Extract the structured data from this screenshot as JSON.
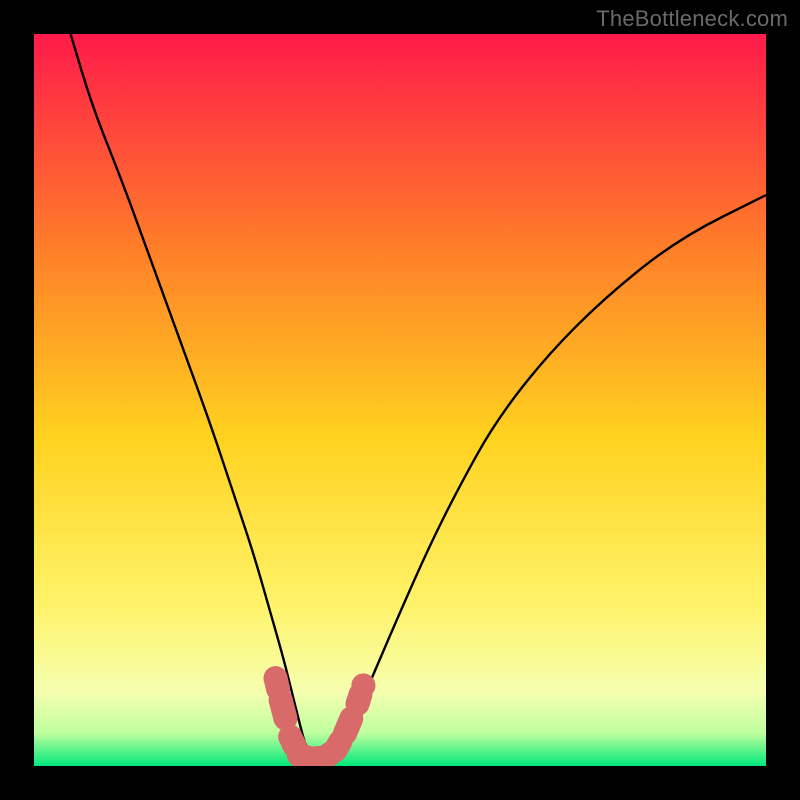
{
  "watermark": "TheBottleneck.com",
  "colors": {
    "frame": "#000000",
    "gradient_top": "#ff1a4a",
    "gradient_mid1": "#ff7a2a",
    "gradient_mid2": "#ffd21f",
    "gradient_mid3": "#fff36a",
    "gradient_mid4": "#f5ffb0",
    "gradient_bottom": "#00e87a",
    "curve": "#000000",
    "marker_fill": "#d86a6a",
    "marker_stroke": "#d86a6a"
  },
  "chart_data": {
    "type": "line",
    "title": "",
    "xlabel": "",
    "ylabel": "",
    "xlim": [
      0,
      100
    ],
    "ylim": [
      0,
      100
    ],
    "grid": false,
    "legend": false,
    "series": [
      {
        "name": "bottleneck-curve",
        "x": [
          5,
          8,
          12,
          16,
          20,
          24,
          27,
          30,
          32,
          34,
          35,
          36,
          37,
          38,
          39,
          40,
          41,
          42,
          44,
          47,
          50,
          54,
          58,
          63,
          70,
          78,
          88,
          100
        ],
        "y": [
          100,
          90,
          80,
          69,
          58,
          47,
          38,
          29,
          22,
          15,
          11,
          7,
          3,
          1,
          1,
          1,
          2,
          3,
          7,
          14,
          21,
          30,
          38,
          47,
          56,
          64,
          72,
          78
        ]
      }
    ],
    "markers": [
      {
        "x": 33.0,
        "y": 12.0
      },
      {
        "x": 33.7,
        "y": 9.0
      },
      {
        "x": 35.0,
        "y": 4.0
      },
      {
        "x": 36.2,
        "y": 1.5
      },
      {
        "x": 38.0,
        "y": 1.0
      },
      {
        "x": 39.8,
        "y": 1.2
      },
      {
        "x": 41.2,
        "y": 2.2
      },
      {
        "x": 42.5,
        "y": 4.5
      },
      {
        "x": 44.2,
        "y": 8.5
      },
      {
        "x": 45.0,
        "y": 11.0
      }
    ],
    "gradient_stops": [
      {
        "offset": 0.0,
        "color": "#ff1a4a"
      },
      {
        "offset": 0.28,
        "color": "#ff7a2a"
      },
      {
        "offset": 0.55,
        "color": "#ffd21f"
      },
      {
        "offset": 0.78,
        "color": "#fff36a"
      },
      {
        "offset": 0.9,
        "color": "#f5ffb0"
      },
      {
        "offset": 0.955,
        "color": "#bfff9e"
      },
      {
        "offset": 1.0,
        "color": "#00e87a"
      }
    ]
  }
}
